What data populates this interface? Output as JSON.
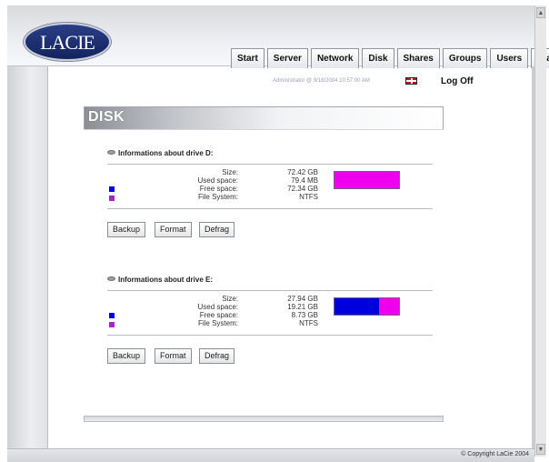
{
  "app": {
    "logo_text": "LACIE"
  },
  "nav": {
    "tabs": [
      {
        "label": "Start"
      },
      {
        "label": "Server"
      },
      {
        "label": "Network"
      },
      {
        "label": "Disk"
      },
      {
        "label": "Shares"
      },
      {
        "label": "Groups"
      },
      {
        "label": "Users"
      },
      {
        "label": "Status"
      }
    ]
  },
  "status_line": {
    "text": "Administrator @ 9/18/2004 10:57:00 AM",
    "flag_icon": "uk-flag-icon",
    "logoff_label": "Log Off"
  },
  "page": {
    "title": "DISK"
  },
  "drives": [
    {
      "heading": "Informations about drive D:",
      "labels": [
        "Size:",
        "Used space:",
        "Free space:",
        "File System:"
      ],
      "values": [
        "72.42 GB",
        "79.4 MB",
        "72.34 GB",
        "NTFS"
      ],
      "used_fraction": 0.001
    },
    {
      "heading": "Informations about drive E:",
      "labels": [
        "Size:",
        "Used space:",
        "Free space:",
        "File System:"
      ],
      "values": [
        "27.94 GB",
        "19.21 GB",
        "8.73 GB",
        "NTFS"
      ],
      "used_fraction": 0.688
    }
  ],
  "buttons": {
    "backup": "Backup",
    "format": "Format",
    "defrag": "Defrag"
  },
  "legend_colors": {
    "used": "#0000dd",
    "free": "#ee00ee"
  },
  "footer": {
    "copyright": "© Copyright LaCie 2004"
  }
}
